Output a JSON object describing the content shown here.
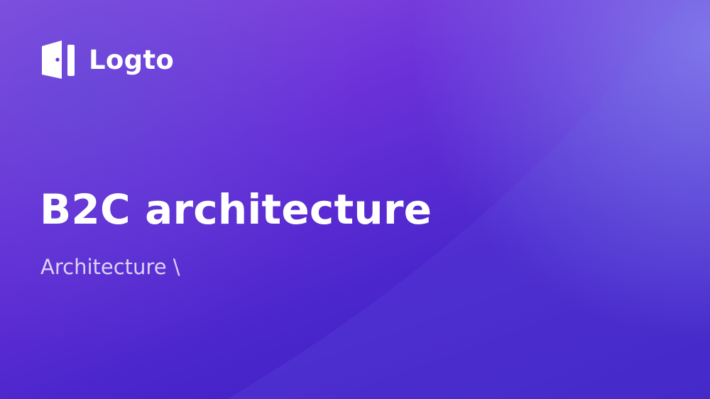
{
  "brand": {
    "name": "Logto",
    "icon": "logto-door-icon"
  },
  "title": "B2C architecture",
  "subtitle": "Architecture \\",
  "colors": {
    "background_top": "#8c4fe0",
    "background_bottom": "#3a1fc2",
    "text": "#ffffff",
    "subtitle_text": "#ddd2f7"
  }
}
